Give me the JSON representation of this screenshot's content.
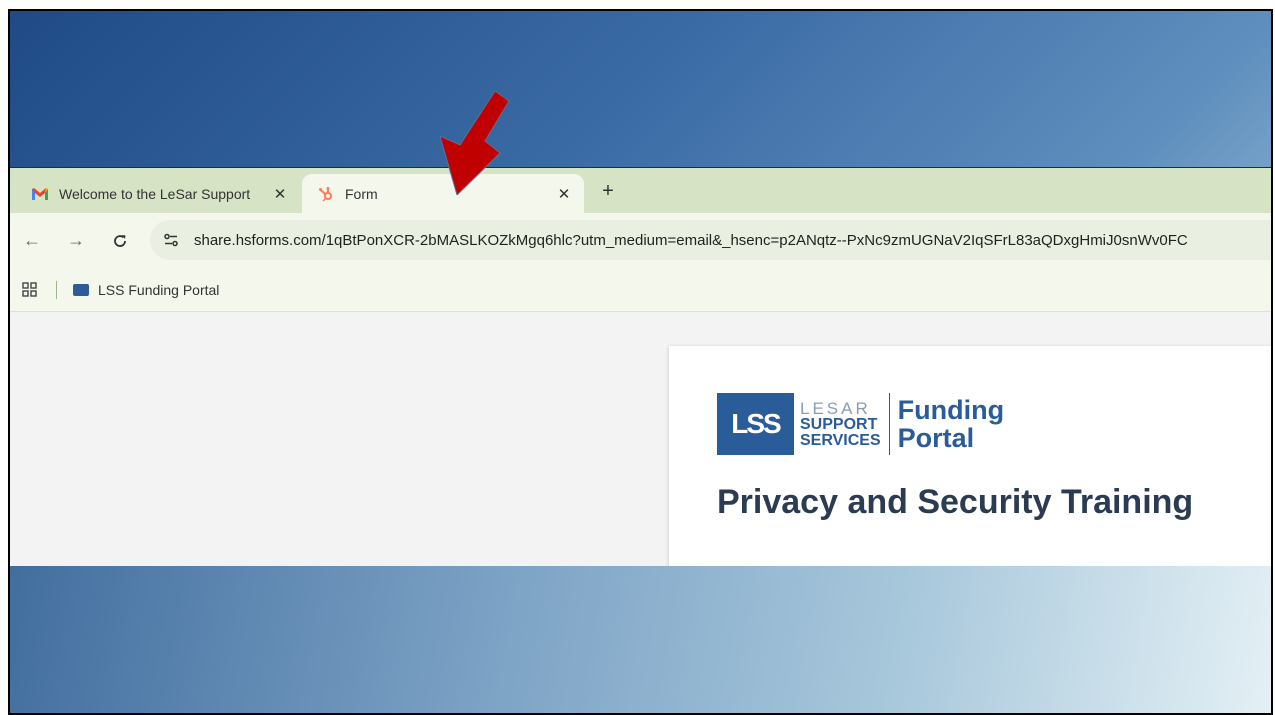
{
  "browser": {
    "tabs": [
      {
        "title": "Welcome to the LeSar Support",
        "favicon": "gmail-icon",
        "active": false
      },
      {
        "title": "Form",
        "favicon": "hubspot-icon",
        "active": true
      }
    ],
    "tab_close_glyph": "✕",
    "new_tab_glyph": "+",
    "toolbar": {
      "back_glyph": "←",
      "forward_glyph": "→",
      "reload_glyph": "C",
      "url": "share.hsforms.com/1qBtPonXCR-2bMASLKOZkMgq6hlc?utm_medium=email&_hsenc=p2ANqtz--PxNc9zmUGNaV2IqSFrL83aQDxgHmiJ0snWv0FC"
    },
    "bookmarks": [
      {
        "label": "LSS Funding Portal",
        "favicon_text": "LSS"
      }
    ]
  },
  "page": {
    "logo": {
      "mark": "LSS",
      "word_1": "LESAR",
      "word_2": "SUPPORT",
      "word_3": "SERVICES",
      "portal_1": "Funding",
      "portal_2": "Portal"
    },
    "title": "Privacy and Security Training"
  },
  "annotation": {
    "arrow_color": "#c00000"
  }
}
